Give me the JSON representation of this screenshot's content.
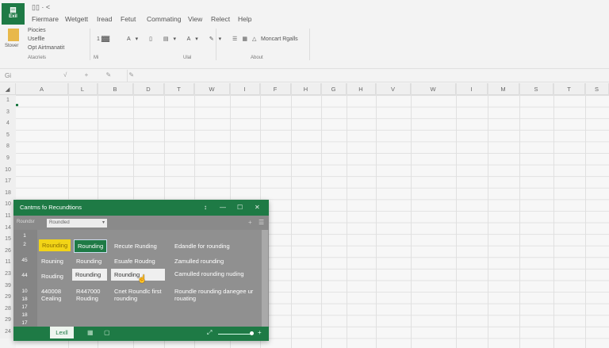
{
  "app": {
    "button_label": "Exil",
    "quick_access": "▯▯ · <"
  },
  "menu": [
    "Fiermare",
    "Wetgett",
    "Iread",
    "Fetut",
    "Commating",
    "View",
    "Relect",
    "Help"
  ],
  "ribbon": {
    "paste_label": "Stover",
    "clipboard_items": [
      "Piocies",
      "Useflle",
      "Opt Airtmanatit"
    ],
    "groups": [
      "Atacriels",
      "Mi",
      "Ulal",
      "About"
    ],
    "font_size": "1 ▓▓",
    "style_dropdown": "Moncart Rgalls"
  },
  "formula_bar": {
    "name_box": "Gi"
  },
  "columns": [
    "A",
    "L",
    "B",
    "D",
    "T",
    "W",
    "I",
    "F",
    "H",
    "G",
    "H",
    "V",
    "W",
    "I",
    "M",
    "S",
    "T",
    "S"
  ],
  "rows": [
    "1",
    "3",
    "4",
    "5",
    "8",
    "9",
    "10",
    "17",
    "18",
    "10",
    "11",
    "14",
    "15",
    "26",
    "11",
    "23",
    "39",
    "29",
    "28",
    "29",
    "24"
  ],
  "dialog": {
    "title": "Cantms fo Recundtions",
    "toolbar_label": "Roundsr",
    "select_value": "Roundled",
    "row_numbers": [
      "1",
      "2",
      "45",
      "44",
      "10",
      "18",
      "17",
      "18",
      "17"
    ],
    "cells": [
      [
        "Rounding",
        "Rounding",
        "Recute Runding",
        "Edandle for rounding"
      ],
      [
        "Rouning",
        "Rounding",
        "Esuafe Roudng",
        "Zamulled rounding"
      ],
      [
        "Rouding",
        "Rounding",
        "Rounding",
        "Camulled rounding nuding"
      ],
      [
        "440008 Cealing",
        "R447000 Rouding",
        "Cnet Roundlc first rounding",
        "Roundle rounding danegee ur rouating"
      ]
    ],
    "bottom_tab": "Lexll"
  },
  "colors": {
    "accent": "#1e7a45",
    "highlight": "#f2d417"
  }
}
